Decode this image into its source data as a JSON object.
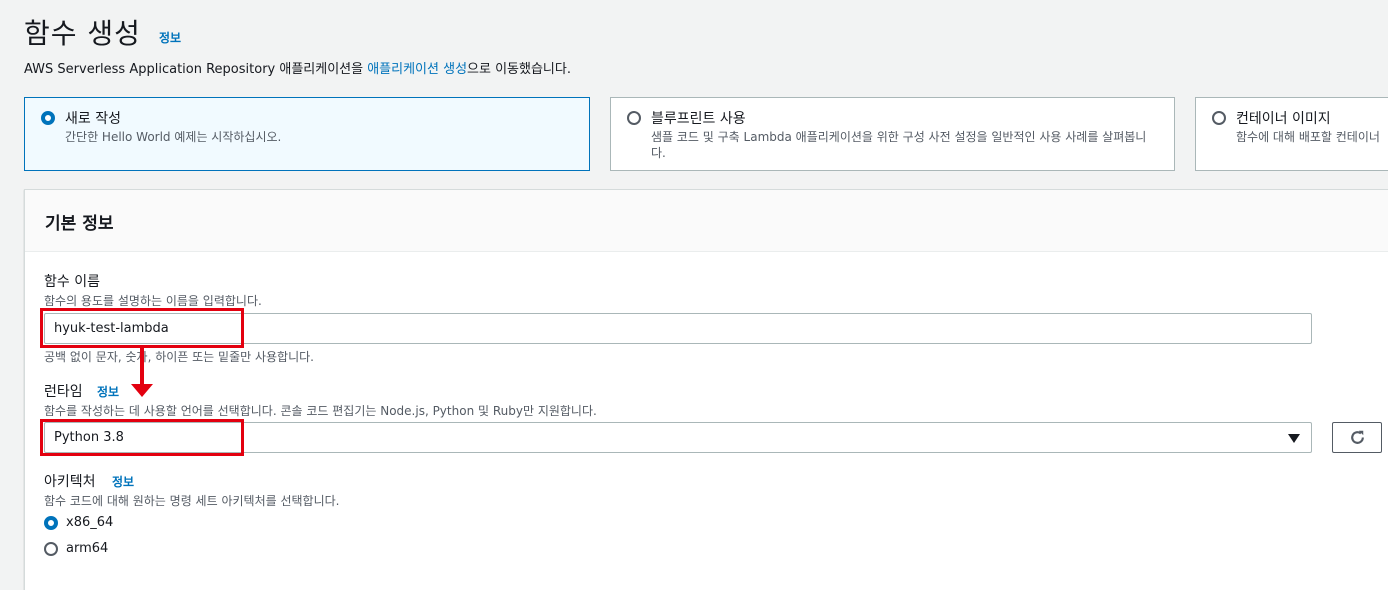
{
  "header": {
    "title": "함수 생성",
    "info_label": "정보",
    "subtitle_prefix": "AWS Serverless Application Repository 애플리케이션을 ",
    "subtitle_link": "애플리케이션 생성",
    "subtitle_suffix": "으로 이동했습니다."
  },
  "options": [
    {
      "title": "새로 작성",
      "desc": "간단한 Hello World 예제는 시작하십시오.",
      "selected": true
    },
    {
      "title": "블루프린트 사용",
      "desc": "샘플 코드 및 구축 Lambda 애플리케이션을 위한 구성 사전 설정을 일반적인 사용 사례를 살펴봅니다.",
      "selected": false
    },
    {
      "title": "컨테이너 이미지",
      "desc": "함수에 대해 배포할 컨테이너",
      "selected": false
    }
  ],
  "basic_info": {
    "title": "기본 정보",
    "function_name": {
      "label": "함수 이름",
      "desc": "함수의 용도를 설명하는 이름을 입력합니다.",
      "value": "hyuk-test-lambda",
      "constraint": "공백 없이 문자, 숫자, 하이픈 또는 밑줄만 사용합니다."
    },
    "runtime": {
      "label": "런타임",
      "info_label": "정보",
      "desc": "함수를 작성하는 데 사용할 언어를 선택합니다. 콘솔 코드 편집기는 Node.js, Python 및 Ruby만 지원합니다.",
      "value": "Python 3.8"
    },
    "architecture": {
      "label": "아키텍처",
      "info_label": "정보",
      "desc": "함수 코드에 대해 원하는 명령 세트 아키텍처를 선택합니다.",
      "options": [
        "x86_64",
        "arm64"
      ],
      "selected": "x86_64"
    }
  },
  "colors": {
    "accent": "#0073bb",
    "annotation": "#e3000f"
  },
  "icons": {
    "refresh": "refresh-icon",
    "dropdown": "caret-down-icon"
  }
}
